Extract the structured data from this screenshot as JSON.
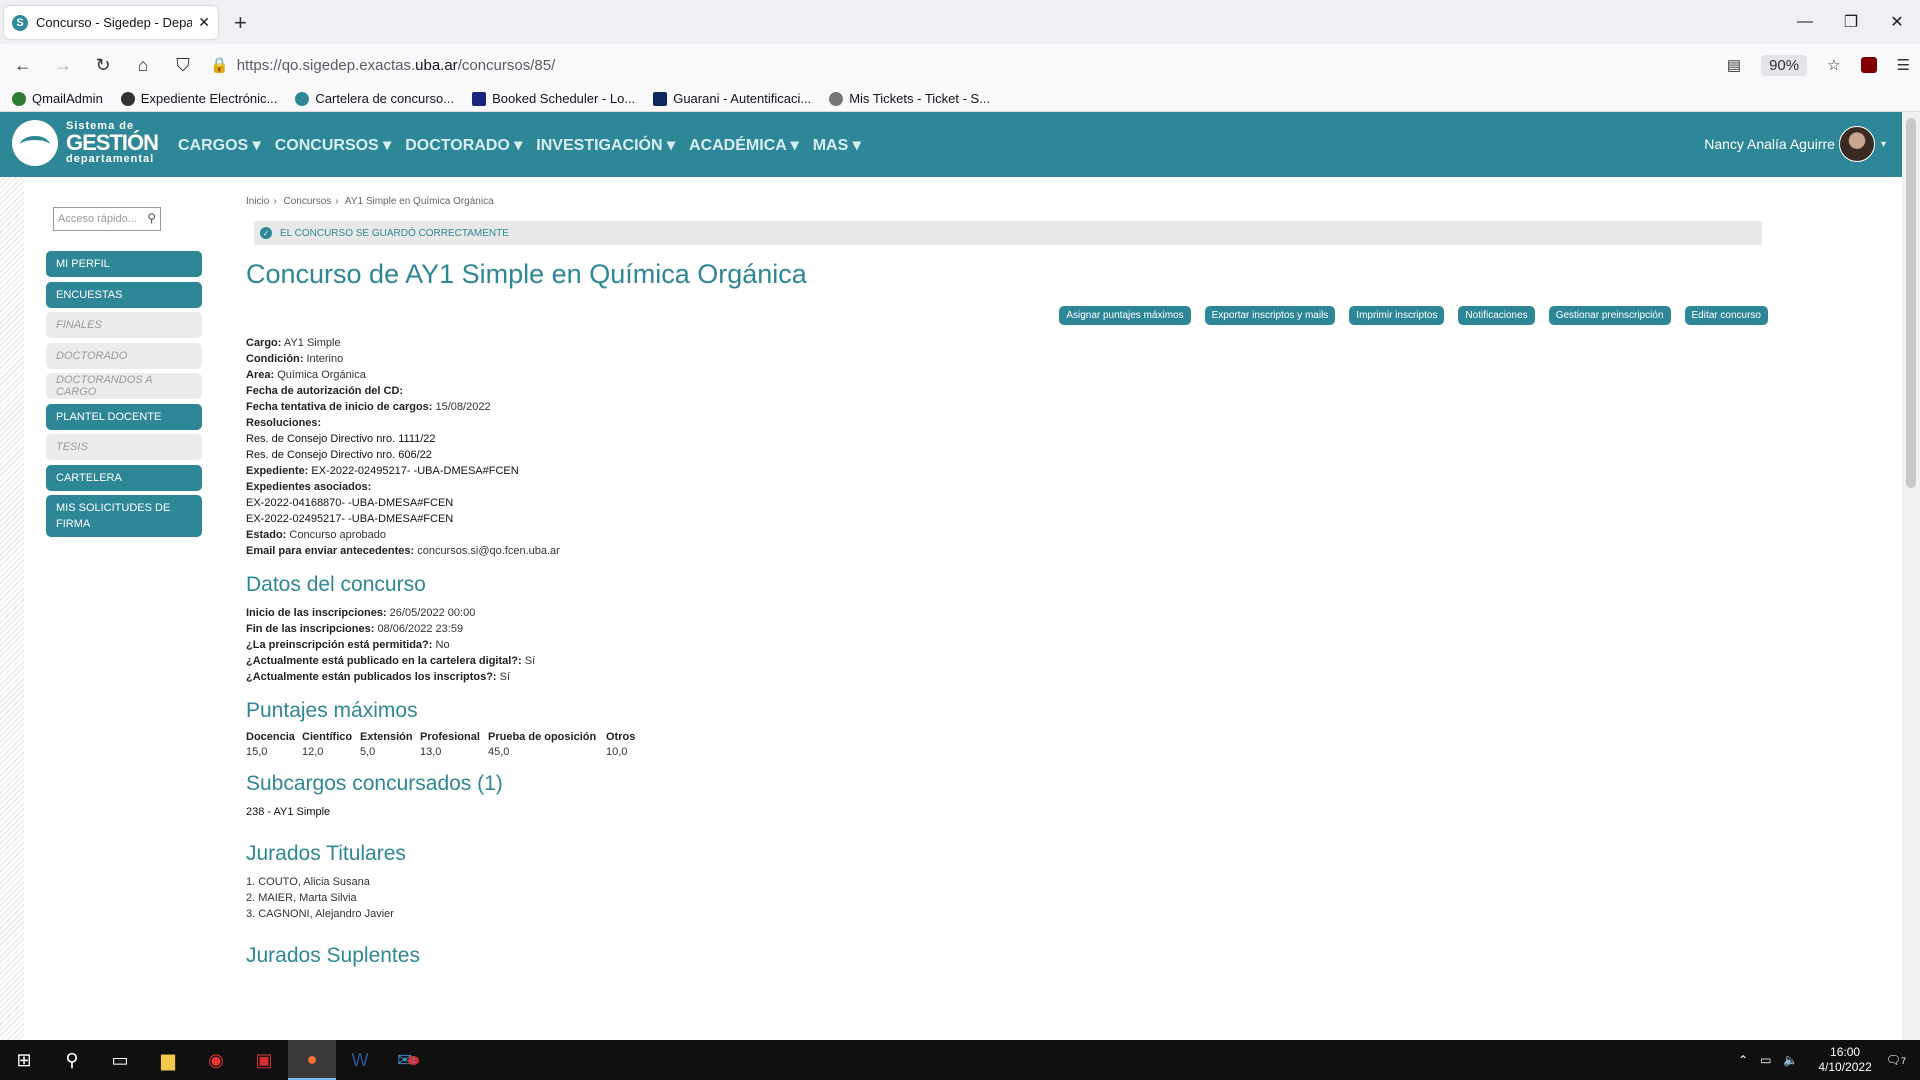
{
  "browser": {
    "tab_title": "Concurso - Sigedep - Departam",
    "url_prefix": "https://qo.sigedep.exactas.",
    "url_host": "uba.ar",
    "url_path": "/concursos/85/",
    "zoom": "90%"
  },
  "bookmarks": [
    "QmailAdmin",
    "Expediente Electrónic...",
    "Cartelera de concurso...",
    "Booked Scheduler - Lo...",
    "Guarani - Autentificaci...",
    "Mis Tickets - Ticket - S..."
  ],
  "logo": {
    "line1": "Sistema de",
    "line2": "GESTIÓN",
    "line3": "departamental"
  },
  "menu": [
    "CARGOS",
    "CONCURSOS",
    "DOCTORADO",
    "INVESTIGACIÓN",
    "ACADÉMICA",
    "MAS"
  ],
  "user": {
    "name": "Nancy Analía Aguirre"
  },
  "search": {
    "placeholder": "Acceso rápido..."
  },
  "sidebar": [
    {
      "label": "MI PERFIL",
      "enabled": true
    },
    {
      "label": "ENCUESTAS",
      "enabled": true
    },
    {
      "label": "FINALES",
      "enabled": false
    },
    {
      "label": "DOCTORADO",
      "enabled": false
    },
    {
      "label": "DOCTORANDOS A CARGO",
      "enabled": false
    },
    {
      "label": "PLANTEL DOCENTE",
      "enabled": true
    },
    {
      "label": "TESIS",
      "enabled": false
    },
    {
      "label": "CARTELERA",
      "enabled": true
    },
    {
      "label": "MIS SOLICITUDES DE FIRMA",
      "enabled": true
    }
  ],
  "breadcrumb": [
    "Inicio",
    "Concursos",
    "AY1 Simple en Química Orgánica"
  ],
  "alert": "EL CONCURSO SE GUARDÓ CORRECTAMENTE",
  "title": "Concurso de AY1 Simple en Química Orgánica",
  "actions": [
    "Asignar puntajes máximos",
    "Exportar inscriptos y mails",
    "Imprimir inscriptos",
    "Notificaciones",
    "Gestionar preinscripción",
    "Editar concurso"
  ],
  "details": {
    "cargo_l": "Cargo:",
    "cargo": "AY1 Simple",
    "cond_l": "Condición:",
    "cond": "Interino",
    "area_l": "Area:",
    "area": "Química Orgánica",
    "fecha_cd_l": "Fecha de autorización del CD:",
    "fecha_inicio_l": "Fecha tentativa de inicio de cargos:",
    "fecha_inicio": "15/08/2022",
    "res_l": "Resoluciones:",
    "res": [
      "Res. de Consejo Directivo nro. 1111/22",
      "Res. de Consejo Directivo nro. 606/22"
    ],
    "exp_l": "Expediente:",
    "exp": "EX-2022-02495217- -UBA-DMESA#FCEN",
    "exps_l": "Expedientes asociados:",
    "exps": [
      "EX-2022-04168870- -UBA-DMESA#FCEN",
      "EX-2022-02495217- -UBA-DMESA#FCEN"
    ],
    "estado_l": "Estado:",
    "estado": "Concurso aprobado",
    "email_l": "Email para enviar antecedentes:",
    "email": "concursos.si@qo.fcen.uba.ar"
  },
  "datos": {
    "title": "Datos del concurso",
    "ini_l": "Inicio de las inscripciones:",
    "ini": "26/05/2022 00:00",
    "fin_l": "Fin de las inscripciones:",
    "fin": "08/06/2022 23:59",
    "pre_l": "¿La preinscripción está permitida?:",
    "pre": "No",
    "pub_l": "¿Actualmente está publicado en la cartelera digital?:",
    "pub": "Sí",
    "ins_l": "¿Actualmente están publicados los inscriptos?:",
    "ins": "Sí"
  },
  "puntajes": {
    "title": "Puntajes máximos",
    "headers": [
      "Docencia",
      "Científico",
      "Extensión",
      "Profesional",
      "Prueba de oposición",
      "Otros"
    ],
    "values": [
      "15,0",
      "12,0",
      "5,0",
      "13,0",
      "45,0",
      "10,0"
    ]
  },
  "subcargos": {
    "title": "Subcargos concursados (1)",
    "items": [
      "238 - AY1 Simple"
    ]
  },
  "titulares": {
    "title": "Jurados Titulares",
    "items": [
      "1. COUTO, Alicia Susana",
      "2. MAIER, Marta Silvia",
      "3. CAGNONI, Alejandro Javier"
    ]
  },
  "suplentes": {
    "title": "Jurados Suplentes"
  },
  "taskbar": {
    "time": "16:00",
    "date": "4/10/2022",
    "badge": "1",
    "notif": "7"
  }
}
